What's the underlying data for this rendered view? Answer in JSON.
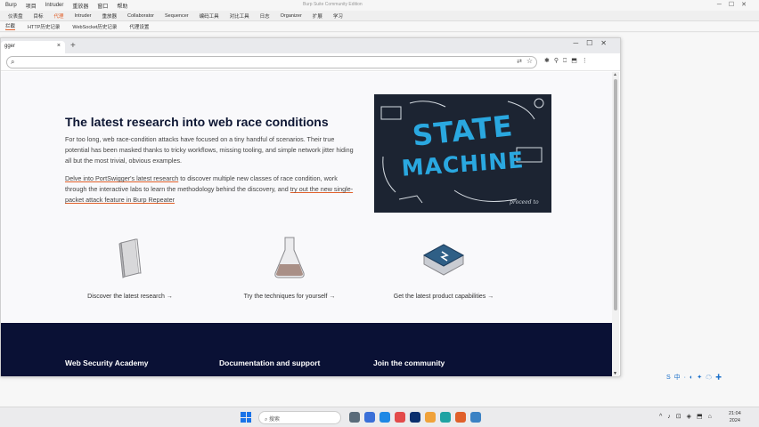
{
  "burp": {
    "menu": [
      "Burp",
      "项目",
      "Intruder",
      "重放器",
      "窗口",
      "帮助"
    ],
    "window_title": "Burp Suite Community Edition",
    "tabs": [
      "仪表盘",
      "目标",
      "代理",
      "Intruder",
      "重放器",
      "Collaborator",
      "Sequencer",
      "编码工具",
      "对比工具",
      "日志",
      "Organizer",
      "扩展",
      "学习"
    ],
    "subtabs": [
      "拦截",
      "HTTP历史记录",
      "WebSocket历史记录",
      "代理设置"
    ]
  },
  "browser": {
    "tab_title": "gger",
    "tab_close": "×",
    "new_tab": "+",
    "url": ""
  },
  "page": {
    "title": "The latest research into web race conditions",
    "p1": "For too long, web race-condition attacks have focused on a tiny handful of scenarios. Their true potential has been masked thanks to tricky workflows, missing tooling, and simple network jitter hiding all but the most trivial, obvious examples.",
    "p2_link1": "Delve into PortSwigger's latest research",
    "p2_mid": " to discover multiple new classes of race condition, work through the interactive labs to learn the methodology behind the discovery, and ",
    "p2_link2": "try out the new single-packet attack feature in Burp Repeater",
    "image_line1": "STATE",
    "image_line2": "MACHINE",
    "image_doodle": "proceed to",
    "features": [
      {
        "label": "Discover the latest research →"
      },
      {
        "label": "Try the techniques for yourself →"
      },
      {
        "label": "Get the latest product capabilities →"
      }
    ],
    "footer": [
      "Web Security Academy",
      "Documentation and support",
      "Join the community"
    ]
  },
  "taskbar": {
    "search": "搜索",
    "time": "21:04",
    "year": "2024"
  },
  "colors": {
    "accent": "#e0602b",
    "footer": "#0a1135",
    "title": "#0d1633"
  }
}
